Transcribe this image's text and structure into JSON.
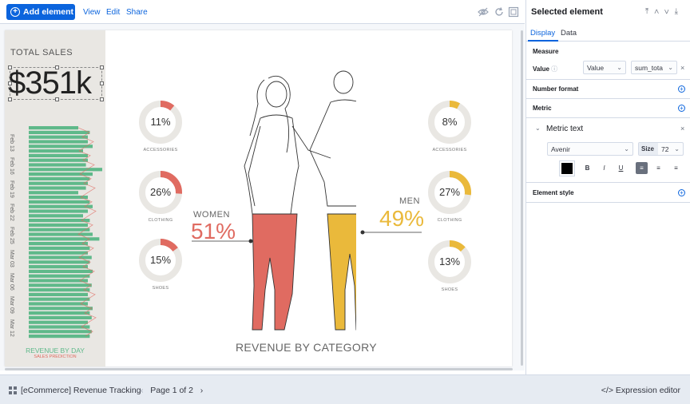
{
  "toolbar": {
    "add_label": "Add element",
    "menus": [
      "View",
      "Edit",
      "Share"
    ]
  },
  "workpad": {
    "total_label": "TOTAL SALES",
    "total_value": "$351k",
    "revenue_by_day": "REVENUE BY DAY",
    "sales_prediction": "SALES PREDICTION",
    "dates": [
      "Feb 13",
      "Feb 16",
      "Feb 19",
      "Feb 22",
      "Feb 25",
      "Mar 03",
      "Mar 06",
      "Mar 09",
      "Mar 12"
    ],
    "bar_levels": [
      0.6,
      0.72,
      0.7,
      0.7,
      0.75,
      0.65,
      0.7,
      0.7,
      0.68,
      0.85,
      0.75,
      0.72,
      0.7,
      0.68,
      0.6,
      0.7,
      0.72,
      0.75,
      0.7,
      0.65,
      0.72,
      0.7,
      0.72,
      0.75,
      0.82,
      0.7,
      0.72,
      0.7,
      0.74,
      0.72,
      0.7,
      0.75,
      0.72,
      0.7,
      0.74,
      0.72,
      0.7,
      0.72,
      0.7,
      0.75,
      0.72,
      0.74,
      0.7,
      0.72,
      0.74,
      0.72
    ],
    "bottom_title": "REVENUE BY CATEGORY",
    "women_label": "WOMEN",
    "women_pct": "51%",
    "men_label": "MEN",
    "men_pct": "49%",
    "women_categories": [
      {
        "pct": "11%",
        "label": "ACCESSORIES",
        "value": 0.11
      },
      {
        "pct": "26%",
        "label": "CLOTHING",
        "value": 0.26
      },
      {
        "pct": "15%",
        "label": "SHOES",
        "value": 0.15
      }
    ],
    "men_categories": [
      {
        "pct": "8%",
        "label": "ACCESSORIES",
        "value": 0.08
      },
      {
        "pct": "27%",
        "label": "CLOTHING",
        "value": 0.27
      },
      {
        "pct": "13%",
        "label": "SHOES",
        "value": 0.13
      }
    ],
    "colors": {
      "women": "#e06b61",
      "men": "#eab93b",
      "bars": "#5fb98a",
      "ring_bg": "#e9e7e3"
    }
  },
  "footer": {
    "workpad_name": "[eCommerce] Revenue Tracking",
    "page_label": "Page 1 of 2",
    "expression_editor": "Expression editor"
  },
  "panel": {
    "title": "Selected element",
    "tabs": [
      "Display",
      "Data"
    ],
    "measure_title": "Measure",
    "value_label": "Value",
    "value_select": "Value",
    "field_select": "sum_tota",
    "number_format": "Number format",
    "metric": "Metric",
    "metric_text": "Metric text",
    "font": "Avenir",
    "size_label": "Size",
    "size_value": "72",
    "text_color": "#000000",
    "element_style": "Element style"
  }
}
